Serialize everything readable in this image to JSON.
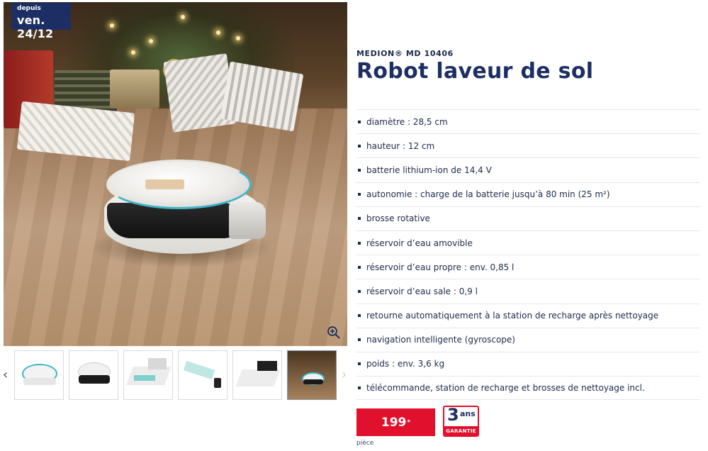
{
  "badge": {
    "line1": "depuis",
    "line2": "ven. 24/12"
  },
  "product": {
    "brand": "MEDION® MD 10406",
    "title": "Robot laveur de sol"
  },
  "specs": [
    "diamètre : 28,5 cm",
    "hauteur : 12 cm",
    "batterie lithium-ion de 14,4 V",
    "autonomie : charge de la batterie jusqu’à 80 min (25 m²)",
    "brosse rotative",
    "réservoir d’eau amovible",
    "réservoir d’eau propre : env. 0,85 l",
    "réservoir d’eau sale : 0,9 l",
    "retourne automatiquement à la station de recharge après nettoyage",
    "navigation intelligente (gyroscope)",
    "poids : env. 3,6 kg",
    "télécommande, station de recharge et brosses de nettoyage incl."
  ],
  "price": {
    "amount": "199",
    "mark": "*",
    "unit": "pièce"
  },
  "warranty": {
    "years": "3",
    "label": "ans",
    "caption": "GARANTIE"
  },
  "gallery": {
    "prev_glyph": "‹",
    "next_glyph": "›",
    "thumbnail_count": 6,
    "active_index": 5
  },
  "colors": {
    "navy": "#1d2e64",
    "red": "#e1102c",
    "teal": "#3fb5c9"
  }
}
